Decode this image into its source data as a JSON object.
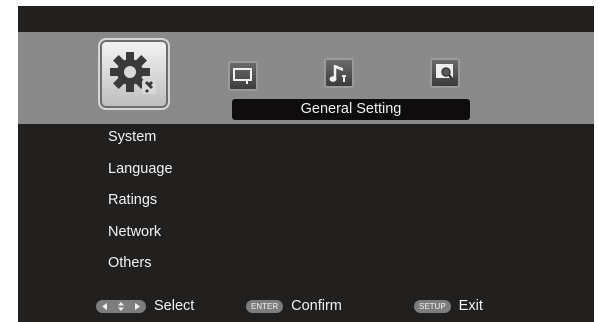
{
  "top_menu": {
    "active_title": "General Setting",
    "icons": [
      {
        "name": "general-setting-gear-wrench-icon",
        "active": true
      },
      {
        "name": "display-setting-screen-wrench-icon",
        "active": false
      },
      {
        "name": "audio-setting-music-note-wrench-icon",
        "active": false
      },
      {
        "name": "preview-setting-search-icon",
        "active": false
      }
    ]
  },
  "menu": {
    "items": [
      {
        "label": "System"
      },
      {
        "label": "Language"
      },
      {
        "label": "Ratings"
      },
      {
        "label": "Network"
      },
      {
        "label": "Others"
      }
    ]
  },
  "footer": {
    "select_label": "Select",
    "enter_key": "ENTER",
    "confirm_label": "Confirm",
    "setup_key": "SETUP",
    "exit_label": "Exit"
  },
  "colors": {
    "background": "#221f1f",
    "band": "#8a8a8a",
    "text": "#f2f2f2",
    "key_badge": "#7d7d7d"
  }
}
